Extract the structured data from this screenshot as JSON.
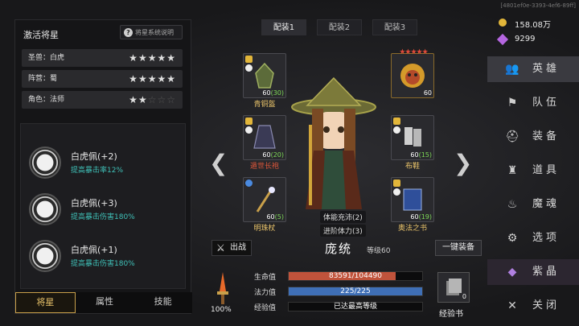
{
  "uid": "[4801ef0e-3393-4ef6-89ff]",
  "left_panel": {
    "title": "激活将星",
    "help": "将星系统说明",
    "attrs": [
      {
        "label": "圣兽：白虎",
        "stars": 5
      },
      {
        "label": "阵营：蜀",
        "stars": 5
      },
      {
        "label": "角色：法师",
        "stars": 2
      }
    ],
    "buffs": [
      {
        "name": "白虎佩(+2)",
        "desc": "提高暴击率12%"
      },
      {
        "name": "白虎佩(+3)",
        "desc": "提高暴击伤害180%"
      },
      {
        "name": "白虎佩(+1)",
        "desc": "提高暴击伤害180%"
      }
    ],
    "tabs": [
      "将星",
      "属性",
      "技能"
    ]
  },
  "loadout_tabs": [
    "配装1",
    "配装2",
    "配装3"
  ],
  "equipment": {
    "helmet": {
      "name": "青铜盔",
      "level": "60",
      "bonus": "(30)"
    },
    "pet": {
      "level": "60"
    },
    "robe": {
      "name": "遁世长袍",
      "level": "60",
      "bonus": "(20)"
    },
    "shoes": {
      "name": "布鞋",
      "level": "60",
      "bonus": "(15)"
    },
    "staff": {
      "name": "明珠杖",
      "level": "60",
      "bonus": "(5)"
    },
    "book": {
      "name": "奥法之书",
      "level": "60",
      "bonus": "(19)"
    }
  },
  "hero": {
    "name": "庞统",
    "level": "等级60",
    "skill1": "体能充沛(2)",
    "skill2": "进阶体力(3)",
    "deploy": "出战",
    "auto_equip": "一键装备",
    "hp_label": "生命值",
    "hp": "83591/104490",
    "hp_ratio": 0.8,
    "mp_label": "法力值",
    "mp": "225/225",
    "mp_ratio": 1.0,
    "exp_label": "经验值",
    "exp": "已达最高等级",
    "power_pct": "100%",
    "exp_book": "经验书",
    "exp_book_count": "0"
  },
  "currency": {
    "gold": "158.08万",
    "gem": "9299"
  },
  "nav": [
    {
      "label": "英雄",
      "icon": "people-icon"
    },
    {
      "label": "队伍",
      "icon": "flag-icon"
    },
    {
      "label": "装备",
      "icon": "helmet-icon"
    },
    {
      "label": "道具",
      "icon": "bag-icon"
    },
    {
      "label": "魔魂",
      "icon": "flame-icon"
    },
    {
      "label": "选项",
      "icon": "gear-icon"
    },
    {
      "label": "紫晶",
      "icon": "crystal-icon"
    },
    {
      "label": "关闭",
      "icon": "close-icon"
    }
  ],
  "colors": {
    "accent": "#e9c36a",
    "hp": "#c0533b",
    "mp": "#3f6fb6",
    "teal": "#3fc1b8"
  }
}
